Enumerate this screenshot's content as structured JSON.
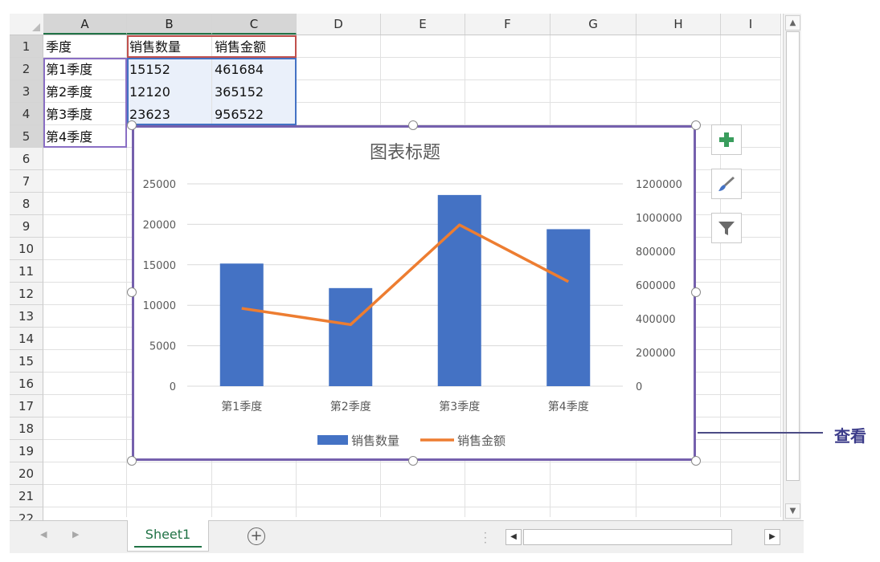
{
  "columns": [
    "A",
    "B",
    "C",
    "D",
    "E",
    "F",
    "G",
    "H",
    "I"
  ],
  "rows": [
    "1",
    "2",
    "3",
    "4",
    "5",
    "6",
    "7",
    "8",
    "9",
    "10",
    "11",
    "12",
    "13",
    "14",
    "15",
    "16",
    "17",
    "18",
    "19",
    "20",
    "21",
    "22"
  ],
  "cells": {
    "A1": "季度",
    "B1": "销售数量",
    "C1": "销售金额",
    "A2": "第1季度",
    "B2": "15152",
    "C2": "461684",
    "A3": "第2季度",
    "B3": "12120",
    "C3": "365152",
    "A4": "第3季度",
    "B4": "23623",
    "C4": "956522",
    "A5": "第4季度"
  },
  "sheet_tab": "Sheet1",
  "add_sheet_label": "+",
  "side_buttons": [
    "plus-icon",
    "brush-icon",
    "filter-icon"
  ],
  "callout_label": "查看",
  "colors": {
    "bar": "#4472c4",
    "line": "#ed7d31",
    "selection": "#7560ad",
    "sheet_green": "#217346"
  },
  "chart_data": {
    "type": "bar",
    "title": "图表标题",
    "categories": [
      "第1季度",
      "第2季度",
      "第3季度",
      "第4季度"
    ],
    "series": [
      {
        "name": "销售数量",
        "type": "bar",
        "axis": "primary",
        "values": [
          15152,
          12120,
          23623,
          19400
        ]
      },
      {
        "name": "销售金额",
        "type": "line",
        "axis": "secondary",
        "values": [
          461684,
          365152,
          956522,
          620000
        ]
      }
    ],
    "y_primary": {
      "ticks": [
        0,
        5000,
        10000,
        15000,
        20000,
        25000
      ],
      "ylim": [
        0,
        25000
      ]
    },
    "y_secondary": {
      "ticks": [
        0,
        200000,
        400000,
        600000,
        800000,
        1000000,
        1200000
      ],
      "ylim": [
        0,
        1200000
      ]
    },
    "grid": true,
    "legend": "bottom"
  }
}
